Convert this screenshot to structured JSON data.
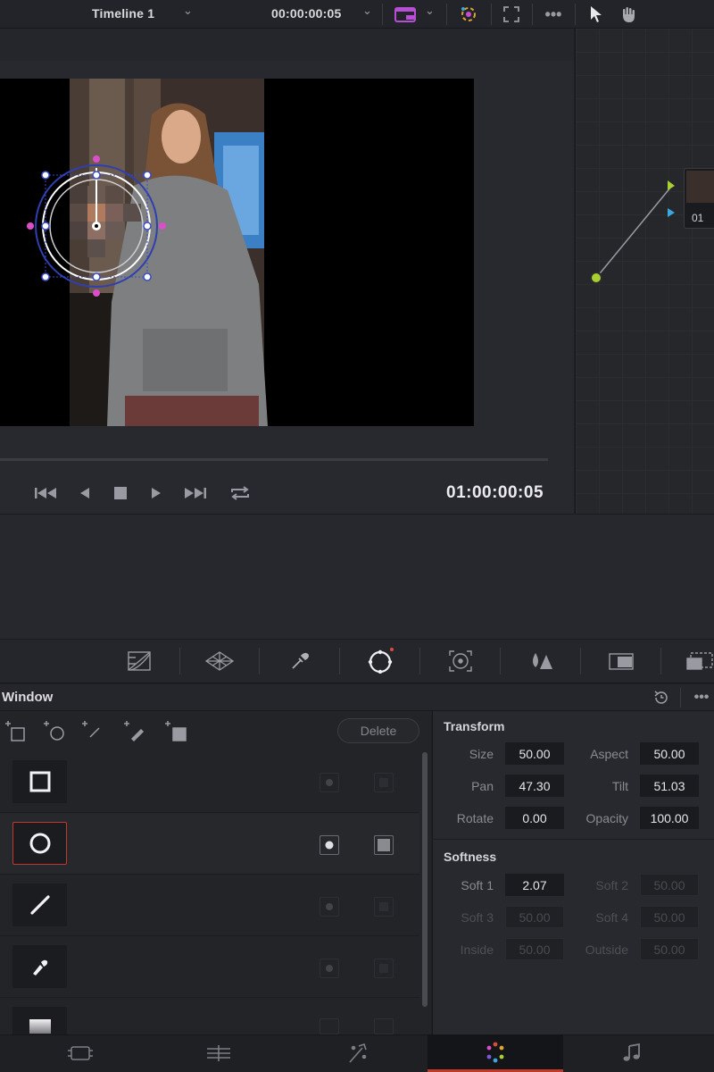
{
  "header": {
    "timeline_name": "Timeline 1",
    "timecode": "00:00:00:05"
  },
  "transport": {
    "timecode": "01:00:00:05"
  },
  "node_editor": {
    "node_label": "01"
  },
  "window_panel": {
    "title": "Window",
    "delete_label": "Delete",
    "shapes": [
      "square",
      "circle",
      "linear",
      "pen",
      "gradient"
    ],
    "selected_shape": "circle"
  },
  "transform": {
    "title": "Transform",
    "size_label": "Size",
    "size_value": "50.00",
    "aspect_label": "Aspect",
    "aspect_value": "50.00",
    "pan_label": "Pan",
    "pan_value": "47.30",
    "tilt_label": "Tilt",
    "tilt_value": "51.03",
    "rotate_label": "Rotate",
    "rotate_value": "0.00",
    "opacity_label": "Opacity",
    "opacity_value": "100.00"
  },
  "softness": {
    "title": "Softness",
    "soft1_label": "Soft 1",
    "soft1_value": "2.07",
    "soft2_label": "Soft 2",
    "soft2_value": "50.00",
    "soft3_label": "Soft 3",
    "soft3_value": "50.00",
    "soft4_label": "Soft 4",
    "soft4_value": "50.00",
    "inside_label": "Inside",
    "inside_value": "50.00",
    "outside_label": "Outside",
    "outside_value": "50.00"
  },
  "bottom_nav": {
    "items": [
      "media",
      "edit",
      "fusion",
      "color",
      "fairlight"
    ],
    "active": "color"
  },
  "colors": {
    "accent_red": "#c0392b",
    "node_green": "#a8d030",
    "node_blue": "#3aa8e0",
    "window_handle_blue": "#3a4cc8",
    "window_handle_pink": "#d94fc8"
  }
}
